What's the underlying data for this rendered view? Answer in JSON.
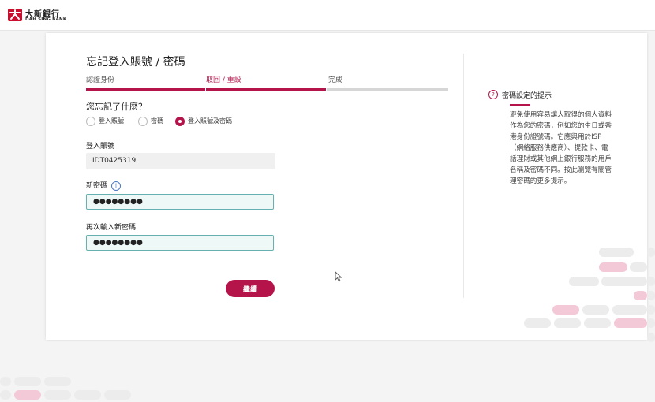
{
  "brand": {
    "name_cn": "大新銀行",
    "name_en": "DAH SING BANK",
    "accent_color": "#b5144a"
  },
  "page": {
    "title": "忘記登入賬號 / 密碼"
  },
  "steps": [
    {
      "label": "認證身份",
      "state": "done"
    },
    {
      "label": "取回 / 重設",
      "state": "current"
    },
    {
      "label": "完成",
      "state": "pending"
    }
  ],
  "form": {
    "question": "您忘記了什麼？",
    "options": [
      {
        "label": "登入賬號",
        "checked": false
      },
      {
        "label": "密碼",
        "checked": false
      },
      {
        "label": "登入賬號及密碼",
        "checked": true
      }
    ],
    "account_label": "登入賬號",
    "account_value": "IDT0425319",
    "new_password_label": "新密碼",
    "new_password_value": "●●●●●●●●",
    "reenter_password_label": "再次輸入新密碼",
    "reenter_password_value": "●●●●●●●●",
    "continue_label": "繼續"
  },
  "tips": {
    "icon": "question-icon",
    "title": "密碼設定的提示",
    "body": "避免使用容易讓人取得的個人資料作為您的密碼，例如您的生日或香港身份證號碼。它應與用於ISP（網絡服務供應商）、提款卡、電話理財或其他網上銀行服務的用戶名稱及密碼不同。按此瀏覽有關管理密碼的更多提示。"
  }
}
